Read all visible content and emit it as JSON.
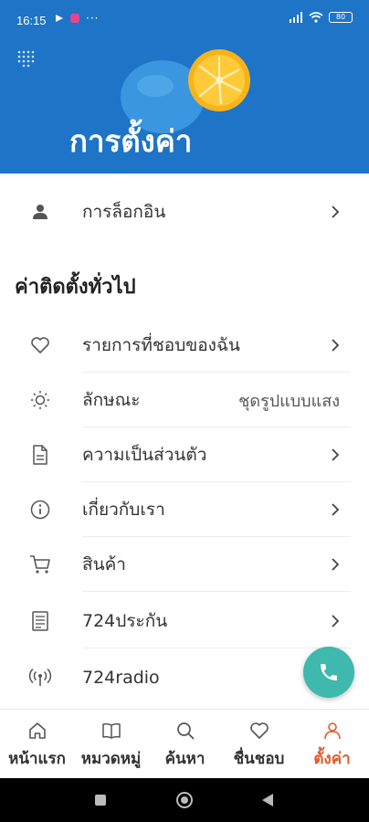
{
  "status": {
    "time": "16:15",
    "battery": "80"
  },
  "header": {
    "title": "การตั้งค่า"
  },
  "login": {
    "label": "การล็อกอิน"
  },
  "section": {
    "title": "ค่าติดตั้งทั่วไป"
  },
  "settings": [
    {
      "label": "รายการที่ชอบของฉัน",
      "icon": "heart-icon"
    },
    {
      "label": "ลักษณะ",
      "icon": "sun-icon",
      "value": "ชุดรูปแบบแสง"
    },
    {
      "label": "ความเป็นส่วนตัว",
      "icon": "document-icon"
    },
    {
      "label": "เกี่ยวกับเรา",
      "icon": "info-icon"
    },
    {
      "label": "สินค้า",
      "icon": "cart-icon"
    },
    {
      "label": "724ประกัน",
      "icon": "receipt-icon"
    },
    {
      "label": "724radio",
      "icon": "radio-icon"
    }
  ],
  "bottom_nav": [
    {
      "label": "หน้าแรก",
      "icon": "home-icon"
    },
    {
      "label": "หมวดหมู่",
      "icon": "book-icon"
    },
    {
      "label": "ค้นหา",
      "icon": "search-icon"
    },
    {
      "label": "ชื่นชอบ",
      "icon": "heart-icon"
    },
    {
      "label": "ตั้งค่า",
      "icon": "user-icon",
      "active": true
    }
  ],
  "colors": {
    "header_bg": "#1e74c6",
    "accent": "#e2592b",
    "fab": "#3fb8ae"
  }
}
